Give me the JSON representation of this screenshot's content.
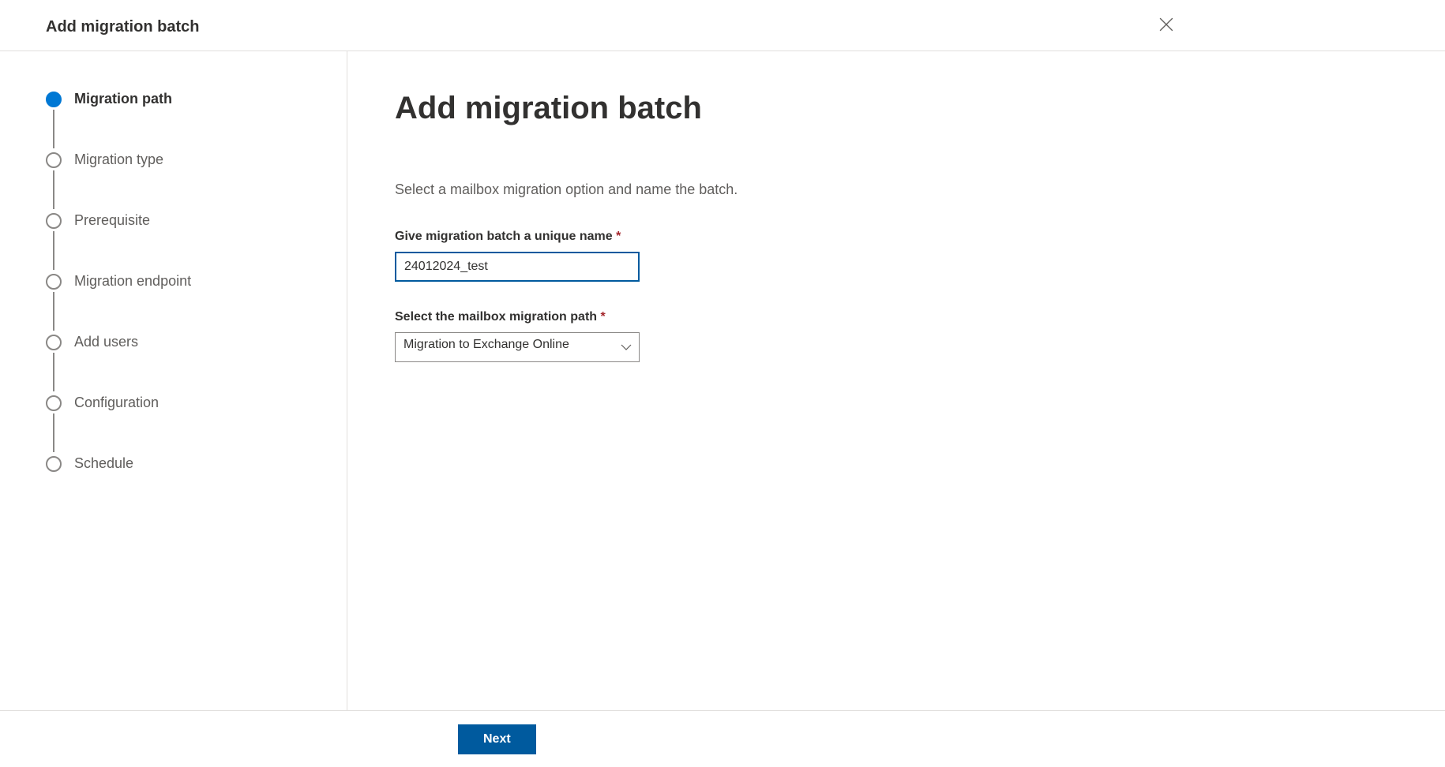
{
  "header": {
    "title": "Add migration batch"
  },
  "steps": [
    {
      "label": "Migration path",
      "active": true
    },
    {
      "label": "Migration type",
      "active": false
    },
    {
      "label": "Prerequisite",
      "active": false
    },
    {
      "label": "Migration endpoint",
      "active": false
    },
    {
      "label": "Add users",
      "active": false
    },
    {
      "label": "Configuration",
      "active": false
    },
    {
      "label": "Schedule",
      "active": false
    }
  ],
  "content": {
    "title": "Add migration batch",
    "description": "Select a mailbox migration option and name the batch.",
    "nameField": {
      "label": "Give migration batch a unique name",
      "value": "24012024_test"
    },
    "pathField": {
      "label": "Select the mailbox migration path",
      "value": "Migration to Exchange Online"
    }
  },
  "footer": {
    "nextLabel": "Next"
  }
}
